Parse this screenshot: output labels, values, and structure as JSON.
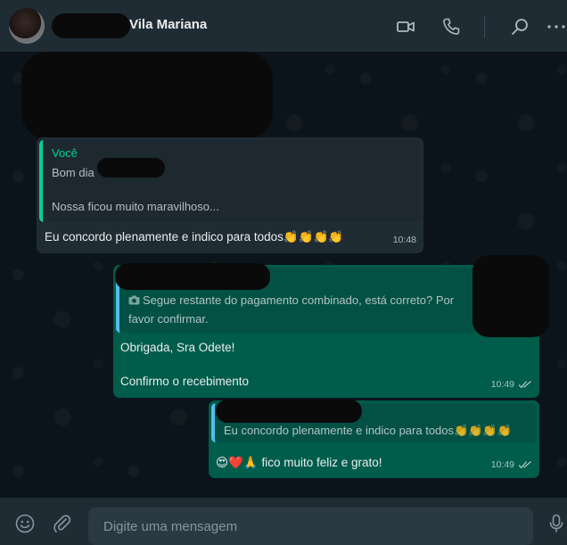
{
  "header": {
    "contact_name": "Vila Mariana",
    "icons": [
      "video-call-icon",
      "voice-call-icon",
      "search-icon",
      "menu-icon"
    ]
  },
  "messages": {
    "m1": {
      "quote_author": "Você",
      "quote_line1": "Bom dia",
      "quote_line2": "Nossa ficou muito maravilhoso...",
      "text": "Eu concordo plenamente e indico para todos👏👏👏👏",
      "time": "10:48"
    },
    "m2": {
      "quote_text_1": "Segue  restante do pagamento  combinado, está correto? Por",
      "quote_text_2": "favor  confirmar.",
      "line1": "Obrigada, Sra Odete!",
      "line2": "Confirmo o recebimento",
      "time": "10:49"
    },
    "m3": {
      "quote_text": "Eu concordo plenamente e indico para todos👏👏👏👏",
      "text": "😍❤️🙏  fico muito feliz e grato!",
      "time": "10:49"
    }
  },
  "footer": {
    "placeholder": "Digite uma mensagem",
    "icons": [
      "emoji-icon",
      "attach-icon",
      "microphone-icon"
    ]
  },
  "colors": {
    "header_bg": "#202c33",
    "chat_bg": "#0b141a",
    "incoming_bubble": "#202c33",
    "outgoing_bubble": "#005c4b",
    "accent": "#06cf9c"
  }
}
